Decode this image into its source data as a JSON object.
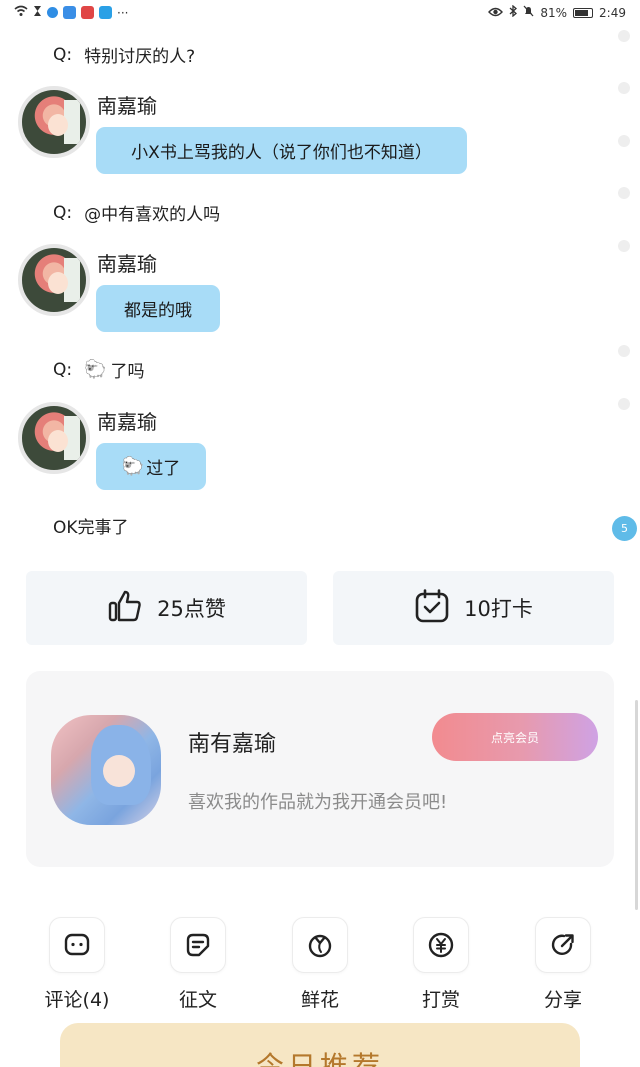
{
  "status_bar": {
    "battery": "81%",
    "time": "2:49",
    "dots": "···"
  },
  "chat": [
    {
      "type": "question",
      "prefix": "Q:",
      "text": "特别讨厌的人?"
    },
    {
      "type": "answer",
      "name": "南嘉瑜",
      "text": "小X书上骂我的人（说了你们也不知道）"
    },
    {
      "type": "question",
      "prefix": "Q:",
      "text": "@中有喜欢的人吗"
    },
    {
      "type": "answer",
      "name": "南嘉瑜",
      "text": "都是的哦"
    },
    {
      "type": "question",
      "prefix": "Q:",
      "emoji": "🐑",
      "text": "了吗"
    },
    {
      "type": "answer",
      "name": "南嘉瑜",
      "emoji": "🐑",
      "text": "过了"
    }
  ],
  "closing_text": "OK完事了",
  "badge_count": "5",
  "actions": {
    "like_label": "25点赞",
    "checkin_label": "10打卡"
  },
  "author_card": {
    "name": "南有嘉瑜",
    "vip_button": "点亮会员",
    "description": "喜欢我的作品就为我开通会员吧!"
  },
  "tools": [
    {
      "label": "评论(4)",
      "icon": "comment-icon"
    },
    {
      "label": "征文",
      "icon": "essay-icon"
    },
    {
      "label": "鲜花",
      "icon": "flower-icon"
    },
    {
      "label": "打赏",
      "icon": "reward-icon"
    },
    {
      "label": "分享",
      "icon": "share-icon"
    }
  ],
  "recommend_title": "今日推荐",
  "colors": {
    "bubble": "#a8dcf7",
    "accent_blue": "#5fbbe8",
    "vip_start": "#f28b8f",
    "vip_end": "#cfa2e4",
    "recommend_bg": "#f6e6c4"
  }
}
